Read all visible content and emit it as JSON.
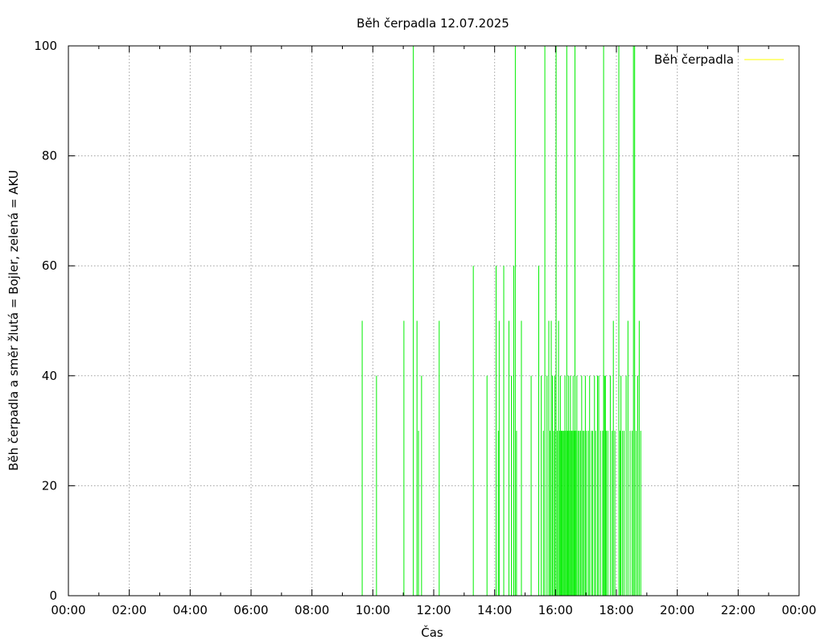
{
  "chart_data": {
    "type": "line",
    "title": "Běh čerpadla 12.07.2025",
    "xlabel": "Čas",
    "ylabel": "Běh čerpadla a směr žlutá = Bojler, zelená = AKU",
    "xlim": [
      0,
      24
    ],
    "ylim": [
      0,
      100
    ],
    "x_unit": "hour",
    "x_ticks": [
      0,
      2,
      4,
      6,
      8,
      10,
      12,
      14,
      16,
      18,
      20,
      22,
      24
    ],
    "x_tick_labels": [
      "00:00",
      "02:00",
      "04:00",
      "06:00",
      "08:00",
      "10:00",
      "12:00",
      "14:00",
      "16:00",
      "18:00",
      "20:00",
      "22:00",
      "00:00"
    ],
    "y_ticks": [
      0,
      20,
      40,
      60,
      80,
      100
    ],
    "y_tick_labels": [
      "0",
      "20",
      "40",
      "60",
      "80",
      "100"
    ],
    "grid": true,
    "legend_position": "top-right",
    "series": [
      {
        "name": "Běh čerpadla",
        "color": "#ffff00",
        "points": []
      },
      {
        "color": "#00ee00",
        "points": [
          [
            9.65,
            50
          ],
          [
            10.12,
            40
          ],
          [
            11.02,
            50
          ],
          [
            11.33,
            100
          ],
          [
            11.45,
            50
          ],
          [
            11.5,
            30
          ],
          [
            11.6,
            40
          ],
          [
            12.18,
            50
          ],
          [
            13.3,
            60
          ],
          [
            13.75,
            40
          ],
          [
            14.05,
            60
          ],
          [
            14.12,
            30
          ],
          [
            14.15,
            50
          ],
          [
            14.3,
            60
          ],
          [
            14.47,
            50
          ],
          [
            14.55,
            40
          ],
          [
            14.63,
            60
          ],
          [
            14.68,
            100
          ],
          [
            14.72,
            30
          ],
          [
            14.88,
            50
          ],
          [
            15.2,
            40
          ],
          [
            15.45,
            60
          ],
          [
            15.53,
            40
          ],
          [
            15.6,
            30
          ],
          [
            15.65,
            100
          ],
          [
            15.72,
            40
          ],
          [
            15.78,
            50
          ],
          [
            15.82,
            30
          ],
          [
            15.86,
            50
          ],
          [
            15.9,
            40
          ],
          [
            15.94,
            30
          ],
          [
            15.98,
            40
          ],
          [
            16.02,
            100
          ],
          [
            16.06,
            30
          ],
          [
            16.1,
            50
          ],
          [
            16.13,
            30
          ],
          [
            16.16,
            40
          ],
          [
            16.19,
            30
          ],
          [
            16.22,
            30
          ],
          [
            16.25,
            30
          ],
          [
            16.28,
            30
          ],
          [
            16.31,
            40
          ],
          [
            16.34,
            30
          ],
          [
            16.37,
            100
          ],
          [
            16.4,
            30
          ],
          [
            16.43,
            40
          ],
          [
            16.46,
            30
          ],
          [
            16.49,
            40
          ],
          [
            16.52,
            30
          ],
          [
            16.55,
            30
          ],
          [
            16.58,
            40
          ],
          [
            16.61,
            30
          ],
          [
            16.64,
            100
          ],
          [
            16.67,
            30
          ],
          [
            16.7,
            40
          ],
          [
            16.74,
            30
          ],
          [
            16.78,
            30
          ],
          [
            16.82,
            30
          ],
          [
            16.86,
            40
          ],
          [
            16.9,
            30
          ],
          [
            16.94,
            30
          ],
          [
            16.98,
            40
          ],
          [
            17.02,
            30
          ],
          [
            17.08,
            30
          ],
          [
            17.12,
            40
          ],
          [
            17.18,
            30
          ],
          [
            17.22,
            30
          ],
          [
            17.28,
            40
          ],
          [
            17.32,
            30
          ],
          [
            17.38,
            40
          ],
          [
            17.42,
            40
          ],
          [
            17.48,
            30
          ],
          [
            17.55,
            30
          ],
          [
            17.58,
            100
          ],
          [
            17.61,
            40
          ],
          [
            17.64,
            40
          ],
          [
            17.67,
            30
          ],
          [
            17.72,
            30
          ],
          [
            17.8,
            40
          ],
          [
            17.86,
            30
          ],
          [
            17.9,
            50
          ],
          [
            17.95,
            30
          ],
          [
            18.08,
            100
          ],
          [
            18.12,
            30
          ],
          [
            18.15,
            40
          ],
          [
            18.2,
            30
          ],
          [
            18.25,
            30
          ],
          [
            18.32,
            40
          ],
          [
            18.38,
            50
          ],
          [
            18.45,
            30
          ],
          [
            18.52,
            30
          ],
          [
            18.56,
            100
          ],
          [
            18.6,
            100
          ],
          [
            18.65,
            30
          ],
          [
            18.7,
            40
          ],
          [
            18.75,
            50
          ],
          [
            18.8,
            30
          ]
        ]
      }
    ]
  }
}
